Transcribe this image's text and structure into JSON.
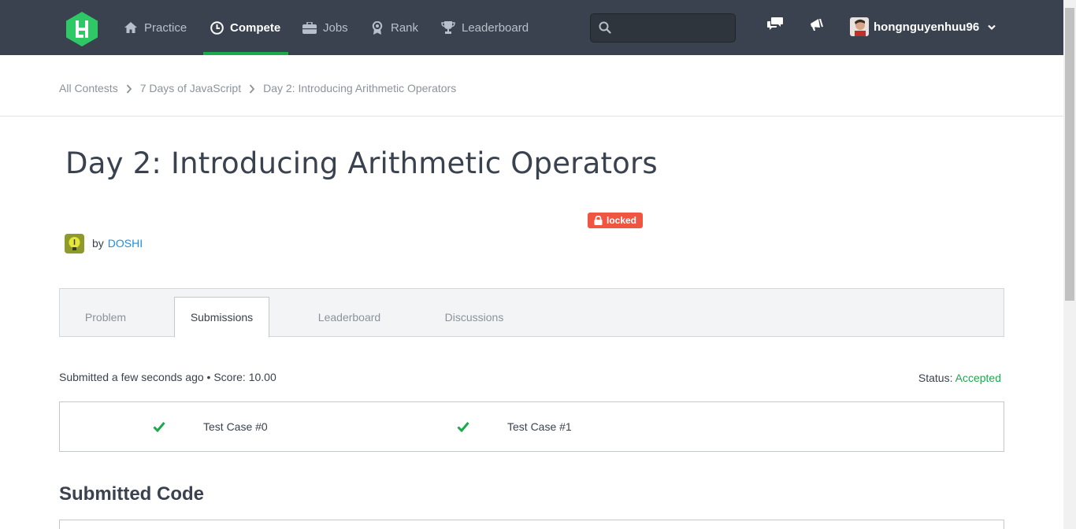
{
  "nav": {
    "items": [
      {
        "label": "Practice",
        "icon": "home-icon"
      },
      {
        "label": "Compete",
        "icon": "clock-icon",
        "active": true
      },
      {
        "label": "Jobs",
        "icon": "briefcase-icon"
      },
      {
        "label": "Rank",
        "icon": "medal-icon"
      },
      {
        "label": "Leaderboard",
        "icon": "trophy-icon"
      }
    ],
    "search_placeholder": "",
    "username": "hongnguyenhuu96"
  },
  "breadcrumb": [
    "All Contests",
    "7 Days of JavaScript",
    "Day 2: Introducing Arithmetic Operators"
  ],
  "challenge": {
    "title": "Day 2: Introducing Arithmetic Operators",
    "locked_label": "locked",
    "by_label": "by",
    "author": "DOSHI"
  },
  "tabs": [
    "Problem",
    "Submissions",
    "Leaderboard",
    "Discussions"
  ],
  "submission": {
    "summary": "Submitted a few seconds ago • Score: 10.00",
    "status_label": "Status:",
    "status_value": "Accepted",
    "test_cases": [
      "Test Case #0",
      "Test Case #1"
    ]
  },
  "code_section_title": "Submitted Code",
  "colors": {
    "nav_bg": "#39424e",
    "accent_green": "#1ba94c",
    "locked_red": "#ef5541",
    "link_blue": "#1a8fe3"
  }
}
